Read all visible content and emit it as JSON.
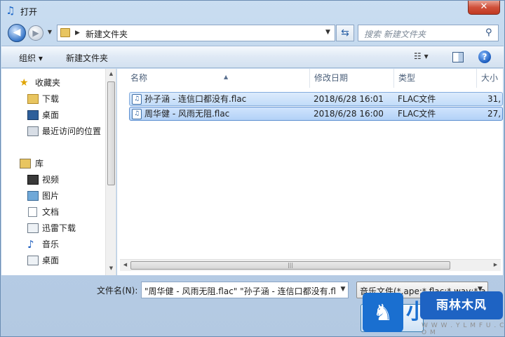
{
  "window": {
    "title": "打开",
    "close_label": "✕"
  },
  "nav_buttons": {
    "back": "◀",
    "forward": "▶",
    "history": "▼"
  },
  "address": {
    "path_arrow": "▶",
    "path": "新建文件夹",
    "dropdown": "▼"
  },
  "refresh": {
    "glyph": "⇆"
  },
  "search": {
    "placeholder": "搜索 新建文件夹",
    "icon_glyph": "⚲"
  },
  "toolbar": {
    "organize": "组织 ▾",
    "new_folder": "新建文件夹",
    "view_glyph": "☷  ▾",
    "help": "?"
  },
  "sidebar": {
    "items": [
      {
        "label": "收藏夹",
        "icon": "star-icon",
        "glyph": "★"
      },
      {
        "label": "下载",
        "icon": "download-folder-icon"
      },
      {
        "label": "桌面",
        "icon": "desktop-icon"
      },
      {
        "label": "最近访问的位置",
        "icon": "recent-places-icon"
      },
      {
        "label": "库",
        "icon": "library-icon"
      },
      {
        "label": "视频",
        "icon": "video-icon"
      },
      {
        "label": "图片",
        "icon": "pictures-icon"
      },
      {
        "label": "文档",
        "icon": "documents-icon"
      },
      {
        "label": "迅雷下载",
        "icon": "xunlei-download-icon"
      },
      {
        "label": "音乐",
        "icon": "music-icon",
        "glyph": "♪"
      },
      {
        "label": "桌面",
        "icon": "desktop-icon"
      }
    ],
    "scroll_up": "▲",
    "scroll_down": "▼"
  },
  "file_list": {
    "columns": [
      "名称",
      "修改日期",
      "类型",
      "大小"
    ],
    "sort_arrow": "▲",
    "rows": [
      {
        "name": "孙子涵 - 连信口都没有.flac",
        "modified": "2018/6/28 16:01",
        "type": "FLAC文件",
        "size": "31,",
        "icon_glyph": "♫"
      },
      {
        "name": "周华健 - 风雨无阻.flac",
        "modified": "2018/6/28 16:00",
        "type": "FLAC文件",
        "size": "27,",
        "icon_glyph": "♫"
      }
    ],
    "hscroll_left": "◀",
    "hscroll_right": "▶",
    "hscroll_grip": "|||"
  },
  "filename": {
    "label": "文件名(N):",
    "value": "\"周华健 - 风雨无阻.flac\" \"孙子涵 - 连信口都没有.fl",
    "dropdown": "▼"
  },
  "filetype": {
    "value": "音乐文件(*.ape;*.flac;*.wav;*.a",
    "dropdown": "▼"
  },
  "watermark": {
    "brand": "雨林木风",
    "url": "W W W . Y L M F U . C O M",
    "big_glyph": "小",
    "horse_glyph": "♞"
  },
  "colors": {
    "accent": "#1a6fd0",
    "selection": "#c2dcf9",
    "close": "#c13a22"
  }
}
